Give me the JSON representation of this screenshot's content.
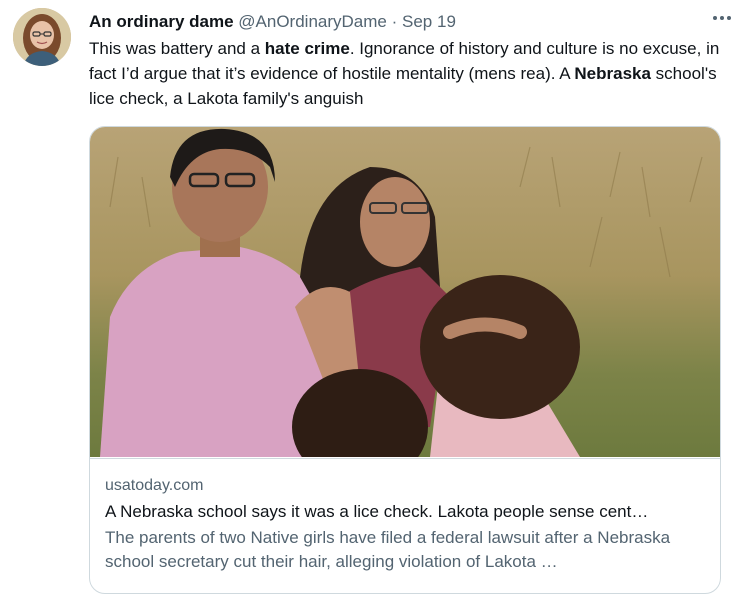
{
  "tweet": {
    "author_name": "An ordinary dame",
    "handle": "@AnOrdinaryDame",
    "separator": "·",
    "date": "Sep 19",
    "text": {
      "part1": "This was battery and a ",
      "bold1": "hate crime",
      "part2": ". Ignorance of history and culture is no excuse, in fact I’d argue that it’s evidence of hostile mentality (mens rea). A ",
      "bold2": "Nebraska",
      "part3": " school's lice check, a Lakota family's anguish"
    }
  },
  "card": {
    "domain": "usatoday.com",
    "title": "A Nebraska school says it was a lice check. Lakota people sense cent…",
    "description": "The parents of two Native girls have filed a federal lawsuit after a Nebraska school secretary cut their hair, alleging violation of Lakota …"
  },
  "icons": {
    "more": "more-horizontal-icon"
  }
}
